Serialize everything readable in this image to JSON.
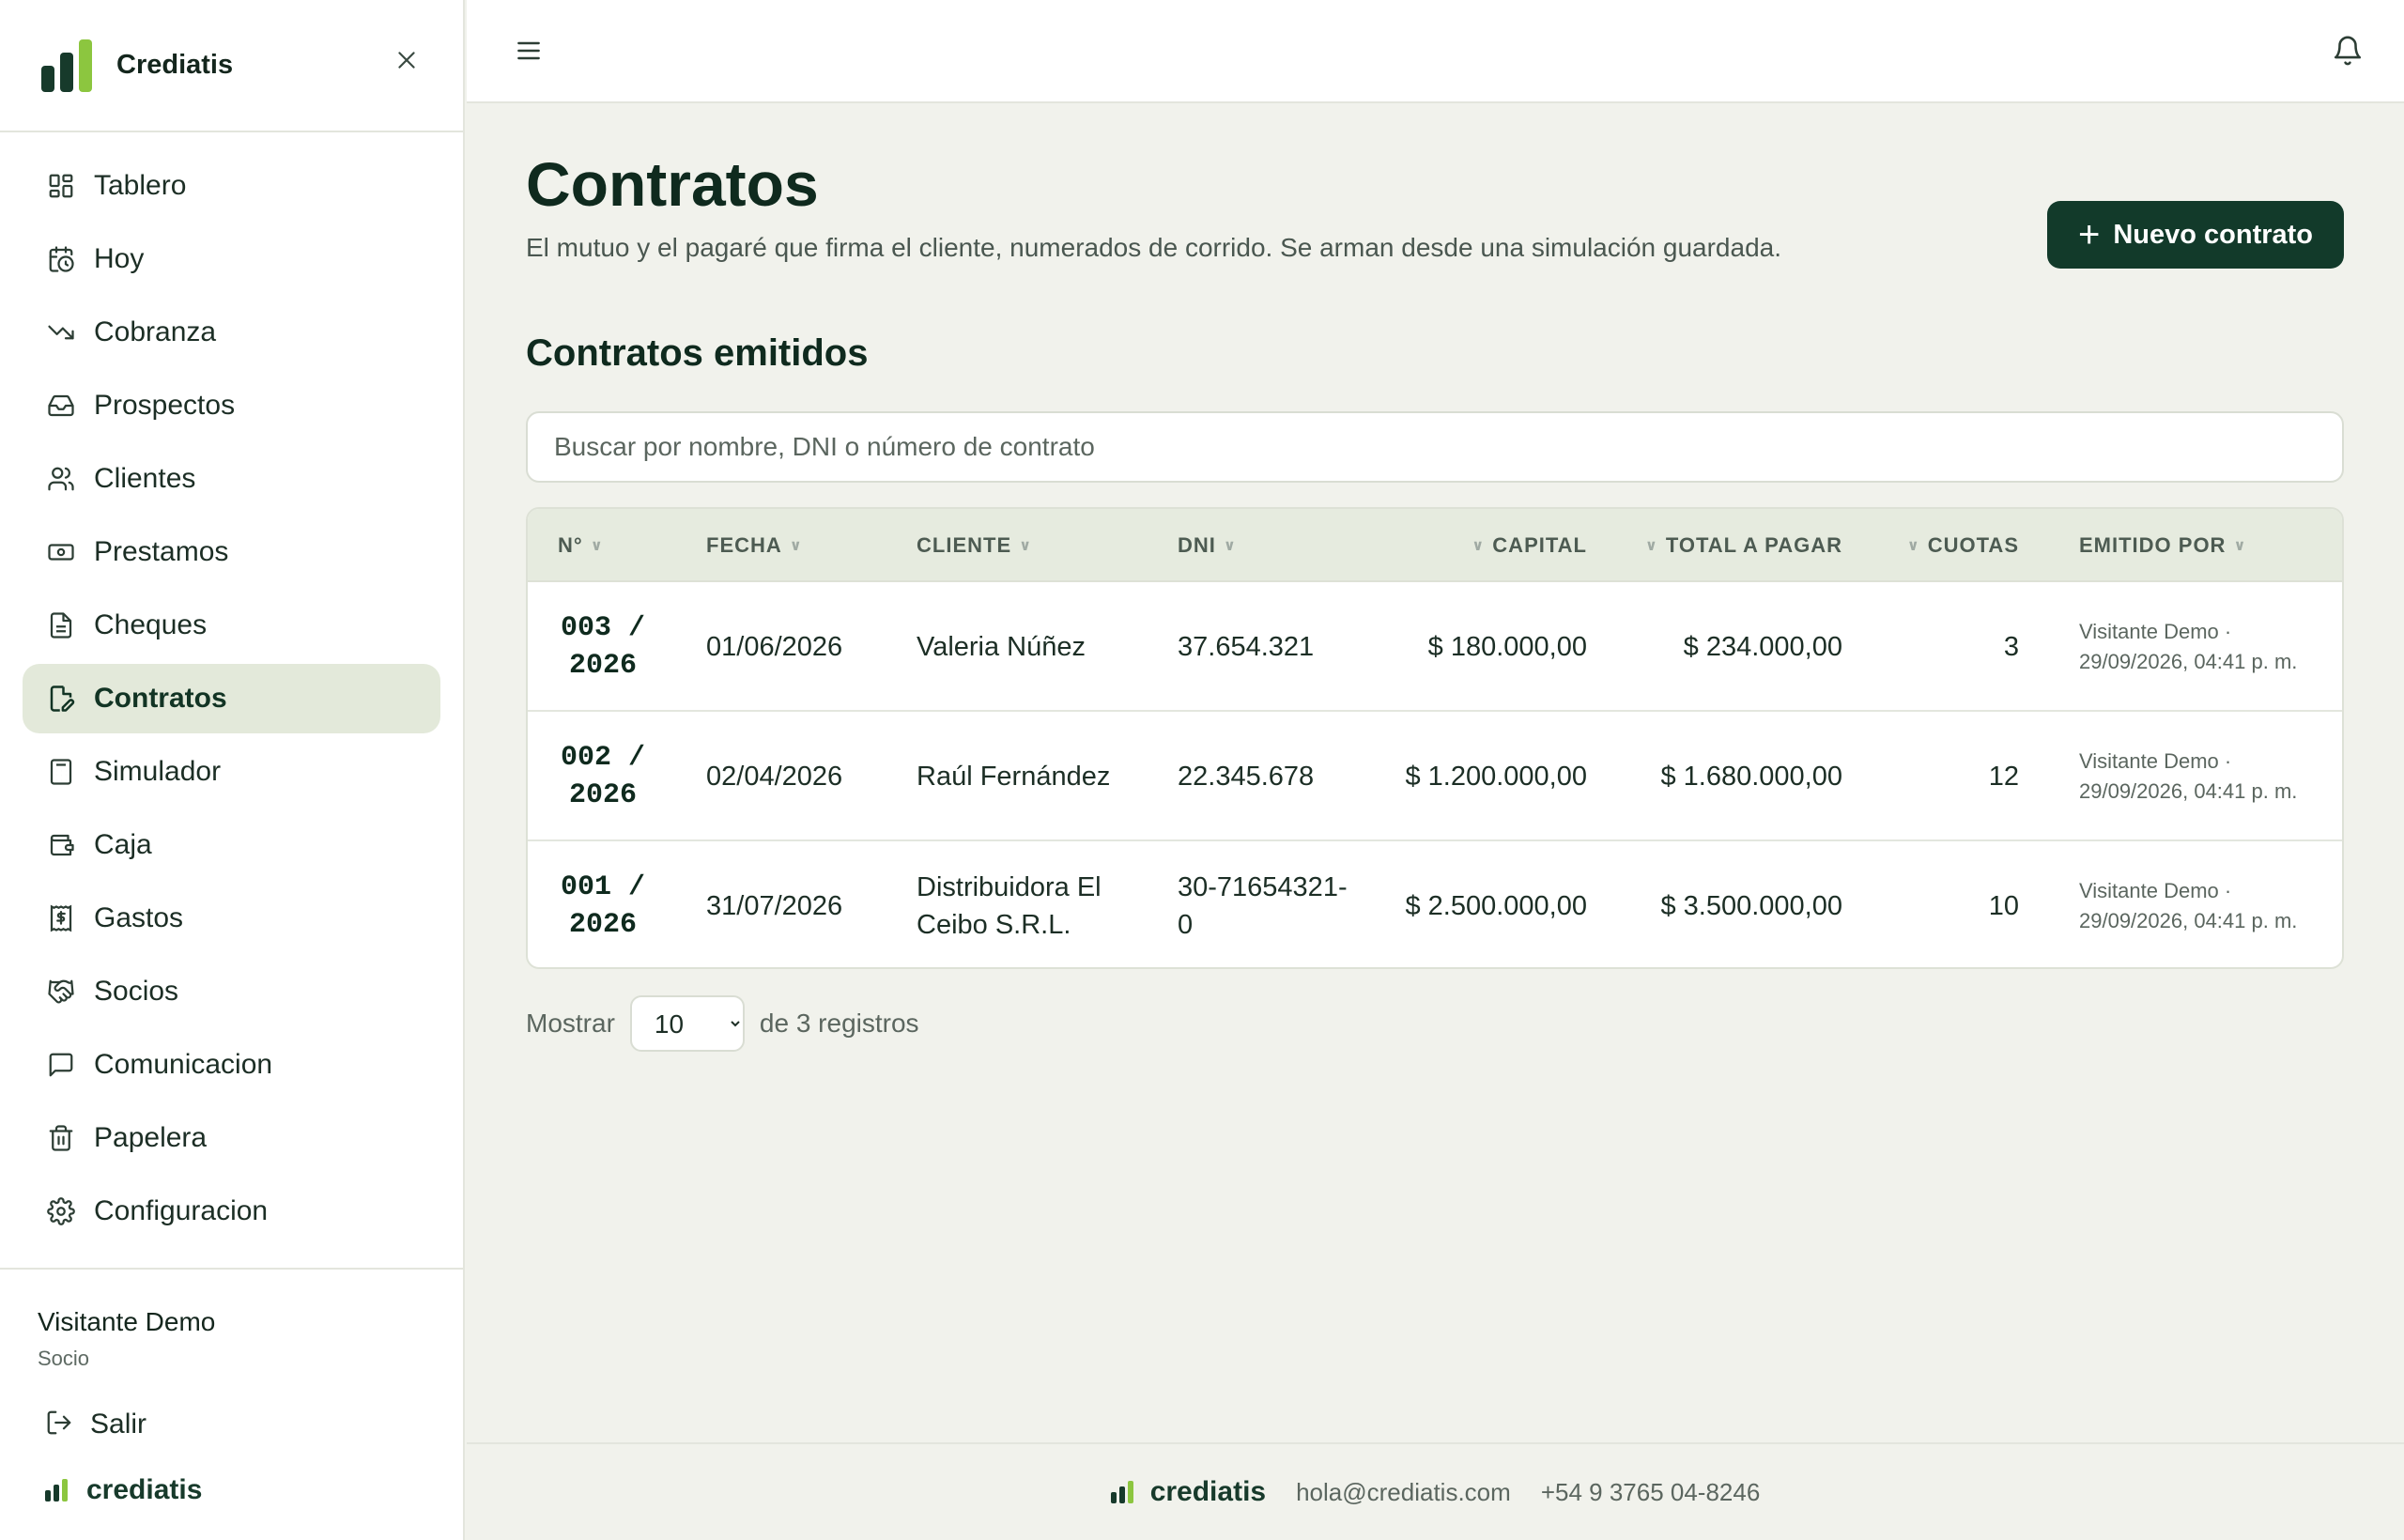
{
  "brand": {
    "name": "Crediatis",
    "footer_name": "crediatis"
  },
  "sidebar": {
    "items": [
      {
        "label": "Tablero",
        "icon": "grid-icon",
        "active": false
      },
      {
        "label": "Hoy",
        "icon": "calendar-clock-icon",
        "active": false
      },
      {
        "label": "Cobranza",
        "icon": "trending-down-icon",
        "active": false
      },
      {
        "label": "Prospectos",
        "icon": "inbox-icon",
        "active": false
      },
      {
        "label": "Clientes",
        "icon": "users-icon",
        "active": false
      },
      {
        "label": "Prestamos",
        "icon": "banknote-icon",
        "active": false
      },
      {
        "label": "Cheques",
        "icon": "document-icon",
        "active": false
      },
      {
        "label": "Contratos",
        "icon": "document-edit-icon",
        "active": true
      },
      {
        "label": "Simulador",
        "icon": "calculator-icon",
        "active": false
      },
      {
        "label": "Caja",
        "icon": "wallet-icon",
        "active": false
      },
      {
        "label": "Gastos",
        "icon": "receipt-dollar-icon",
        "active": false
      },
      {
        "label": "Socios",
        "icon": "handshake-icon",
        "active": false
      },
      {
        "label": "Comunicacion",
        "icon": "message-square-icon",
        "active": false
      },
      {
        "label": "Papelera",
        "icon": "trash-icon",
        "active": false
      },
      {
        "label": "Configuracion",
        "icon": "gear-icon",
        "active": false
      }
    ],
    "user": {
      "name": "Visitante Demo",
      "role": "Socio"
    },
    "logout_label": "Salir"
  },
  "main": {
    "title": "Contratos",
    "subtitle": "El mutuo y el pagaré que firma el cliente, numerados de corrido. Se arman desde una simulación guardada.",
    "new_button_label": "Nuevo contrato",
    "section_title": "Contratos emitidos",
    "search_placeholder": "Buscar por nombre, DNI o número de contrato",
    "table": {
      "headers": [
        "N°",
        "FECHA",
        "CLIENTE",
        "DNI",
        "CAPITAL",
        "TOTAL A PAGAR",
        "CUOTAS",
        "EMITIDO POR"
      ],
      "rows": [
        {
          "num_a": "003 /",
          "num_b": "2026",
          "fecha": "01/06/2026",
          "cliente": "Valeria Núñez",
          "dni": "37.654.321",
          "capital": "$ 180.000,00",
          "total": "$ 234.000,00",
          "cuotas": "3",
          "emitido": "Visitante Demo · 29/09/2026, 04:41 p. m."
        },
        {
          "num_a": "002 /",
          "num_b": "2026",
          "fecha": "02/04/2026",
          "cliente": "Raúl Fernández",
          "dni": "22.345.678",
          "capital": "$ 1.200.000,00",
          "total": "$ 1.680.000,00",
          "cuotas": "12",
          "emitido": "Visitante Demo · 29/09/2026, 04:41 p. m."
        },
        {
          "num_a": "001 /",
          "num_b": "2026",
          "fecha": "31/07/2026",
          "cliente": "Distribuidora El Ceibo S.R.L.",
          "dni": "30-71654321-0",
          "capital": "$ 2.500.000,00",
          "total": "$ 3.500.000,00",
          "cuotas": "10",
          "emitido": "Visitante Demo · 29/09/2026, 04:41 p. m."
        }
      ]
    },
    "pager": {
      "show_label": "Mostrar",
      "page_size": "10",
      "count_label": "de 3 registros"
    }
  },
  "footer": {
    "email": "hola@crediatis.com",
    "phone": "+54 9 3765 04-8246"
  },
  "colors": {
    "accent": "#123a2a",
    "brand_green": "#8cc63f",
    "active_bg": "#e3e9da"
  }
}
